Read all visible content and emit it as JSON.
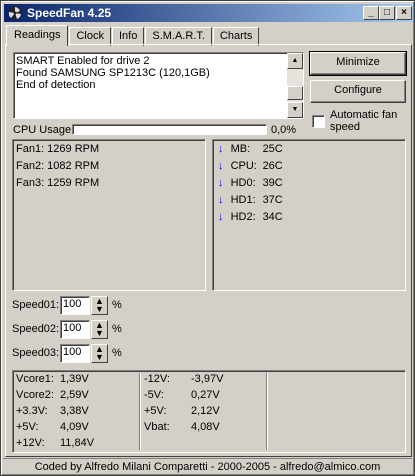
{
  "window": {
    "title": "SpeedFan 4.25",
    "buttons": {
      "minimize": "_",
      "maximize": "□",
      "close": "×"
    }
  },
  "tabs": [
    "Readings",
    "Clock",
    "Info",
    "S.M.A.R.T.",
    "Charts"
  ],
  "log": [
    "SMART Enabled for drive 2",
    "Found SAMSUNG SP1213C (120,1GB)",
    "End of detection"
  ],
  "buttons": {
    "minimize": "Minimize",
    "configure": "Configure"
  },
  "auto_fan": {
    "label_line1": "Automatic fan",
    "label_line2": "speed",
    "checked": false
  },
  "cpu": {
    "label": "CPU Usage",
    "value": "0,0%"
  },
  "fans": [
    "Fan1: 1269 RPM",
    "Fan2: 1082 RPM",
    "Fan3: 1259 RPM"
  ],
  "temps": [
    {
      "name": "MB:",
      "value": "25C",
      "icon": "arrow-down-icon"
    },
    {
      "name": "CPU:",
      "value": "26C",
      "icon": "arrow-down-icon"
    },
    {
      "name": "HD0:",
      "value": "39C",
      "icon": "arrow-down-icon"
    },
    {
      "name": "HD1:",
      "value": "37C",
      "icon": "arrow-down-icon"
    },
    {
      "name": "HD2:",
      "value": "34C",
      "icon": "arrow-down-icon"
    }
  ],
  "speeds": [
    {
      "label": "Speed01:",
      "value": "100",
      "unit": "%"
    },
    {
      "label": "Speed02:",
      "value": "100",
      "unit": "%"
    },
    {
      "label": "Speed03:",
      "value": "100",
      "unit": "%"
    }
  ],
  "voltages_left": [
    {
      "name": "Vcore1:",
      "value": "1,39V"
    },
    {
      "name": "Vcore2:",
      "value": "2,59V"
    },
    {
      "name": "+3.3V:",
      "value": "3,38V"
    },
    {
      "name": "+5V:",
      "value": "4,09V"
    },
    {
      "name": "+12V:",
      "value": "11,84V"
    }
  ],
  "voltages_right": [
    {
      "name": "-12V:",
      "value": "-3,97V"
    },
    {
      "name": "-5V:",
      "value": "0,27V"
    },
    {
      "name": "+5V:",
      "value": "2,12V"
    },
    {
      "name": "Vbat:",
      "value": "4,08V"
    }
  ],
  "status": "Coded by Alfredo Milani Comparetti - 2000-2005 - alfredo@almico.com",
  "colors": {
    "title_start": "#0a246a",
    "title_end": "#a6caf0",
    "arrow": "#0000ff",
    "face": "#d4d0c8"
  }
}
